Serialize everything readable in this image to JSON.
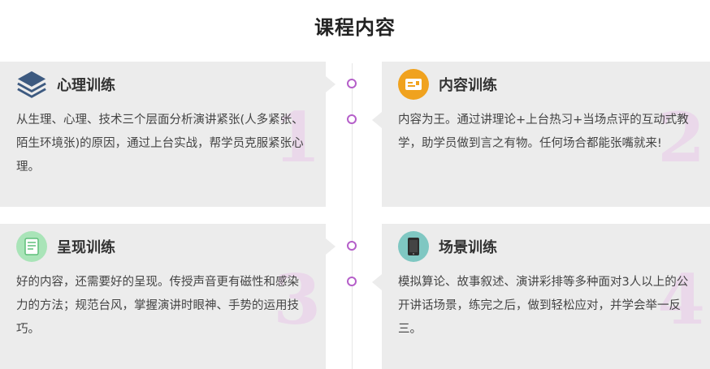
{
  "section_title": "课程内容",
  "cards": [
    {
      "number": "1",
      "title": "心理训练",
      "icon": "stack-layers-icon",
      "desc": "从生理、心理、技术三个层面分析演讲紧张(人多紧张、陌生环境张)的原因，通过上台实战，帮学员克服紧张心理。"
    },
    {
      "number": "2",
      "title": "内容训练",
      "icon": "id-card-icon",
      "desc": "内容为王。通过讲理论+上台热习+当场点评的互动式教学，助学员做到言之有物。任何场合都能张嘴就来!"
    },
    {
      "number": "3",
      "title": "呈现训练",
      "icon": "notebook-icon",
      "desc": "好的内容，还需要好的呈现。传授声音更有磁性和感染力的方法；规范台风，掌握演讲时眼神、手势的运用技巧。"
    },
    {
      "number": "4",
      "title": "场景训练",
      "icon": "tablet-icon",
      "desc": "模拟算论、故事叙述、演讲彩排等多种面对3人以上的公开讲话场景，练完之后，做到轻松应对，并学会举一反三。"
    }
  ],
  "colors": {
    "accent": "#b55fc9",
    "card_bg": "#ececec",
    "number": "#ead8ea"
  }
}
